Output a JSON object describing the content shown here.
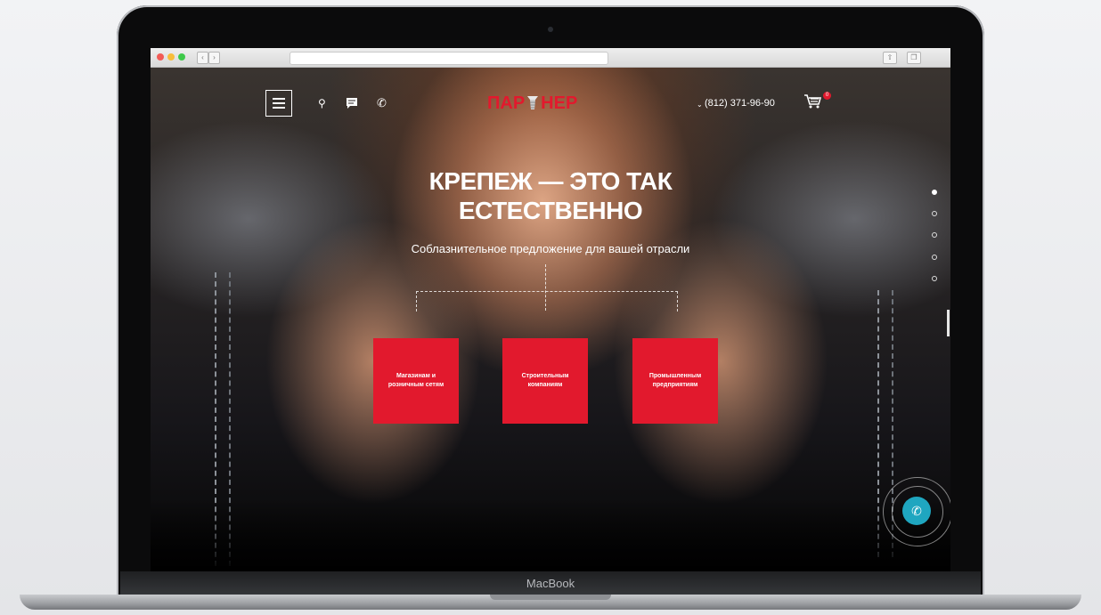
{
  "device": {
    "brand_label": "MacBook"
  },
  "site": {
    "logo_text_left": "ПАР",
    "logo_text_right": "НЕР",
    "phone": "(812) 371-96-90",
    "cart_count": "0",
    "headline_line1": "КРЕПЕЖ — ЭТО ТАК",
    "headline_line2": "ЕСТЕСТВЕННО",
    "subtitle": "Соблазнительное предложение для вашей отрасли",
    "cards": [
      {
        "label": "Магазинам и розничным сетям"
      },
      {
        "label": "Строительным компаниям"
      },
      {
        "label": "Промышленным предприятиям"
      }
    ],
    "slider": {
      "total": 5,
      "active": 1
    }
  },
  "icons": [
    "hamburger-menu-icon",
    "search-icon",
    "chat-icon",
    "phone-icon",
    "cart-icon",
    "callback-phone-icon"
  ],
  "colors": {
    "brand_red": "#e2192d",
    "callback_teal": "#1fa6c0"
  }
}
